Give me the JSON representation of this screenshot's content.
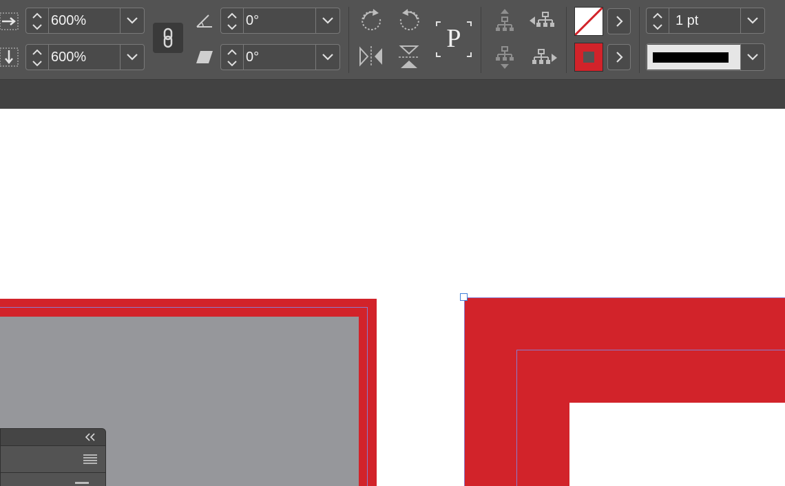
{
  "toolbar": {
    "scale_x": "600%",
    "scale_y": "600%",
    "rotation": "0°",
    "shear": "0°",
    "stroke_weight": "1 pt",
    "text_frame_icon_letter": "P"
  },
  "colors": {
    "toolbar_bg": "#535353",
    "tabbar_bg": "#424242",
    "canvas_bg": "#ffffff",
    "frame_red": "#d2232a",
    "page_gray": "#96979b",
    "guide_purple": "#8a7ccf",
    "panel_bg": "#535353"
  },
  "icons": [
    "scale-x-icon",
    "scale-y-icon",
    "constrain-proportions-icon",
    "rotation-angle-icon",
    "shear-angle-icon",
    "rotate-clockwise-icon",
    "rotate-counterclockwise-icon",
    "flip-horizontal-icon",
    "flip-vertical-icon",
    "text-frame-icon",
    "select-container-icon",
    "select-previous-object-icon",
    "select-content-icon",
    "select-next-object-icon",
    "fill-swatch-icon",
    "stroke-swatch-icon",
    "collapse-panel-icon",
    "panel-menu-icon"
  ]
}
